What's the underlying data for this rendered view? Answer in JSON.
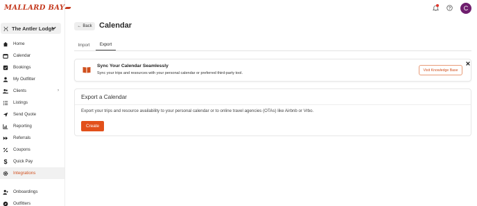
{
  "brand": {
    "logo_text": "MALLARD BAY",
    "accent": "#d0501e",
    "button": "#e2501b"
  },
  "lodge": {
    "name": "The Antler Lodge"
  },
  "sidebar": {
    "items": [
      {
        "label": "Home",
        "icon": "home-icon"
      },
      {
        "label": "Calendar",
        "icon": "calendar-icon"
      },
      {
        "label": "Bookings",
        "icon": "bookings-icon"
      },
      {
        "label": "My Outfitter",
        "icon": "user-icon"
      },
      {
        "label": "Clients",
        "icon": "users-icon"
      },
      {
        "label": "Listings",
        "icon": "list-icon"
      },
      {
        "label": "Send Quote",
        "icon": "send-icon"
      },
      {
        "label": "Reporting",
        "icon": "chart-icon"
      },
      {
        "label": "Referrals",
        "icon": "fast-forward-icon"
      },
      {
        "label": "Coupons",
        "icon": "percent-icon"
      },
      {
        "label": "Quick Pay",
        "icon": "dollar-icon"
      },
      {
        "label": "Integrations",
        "icon": "gear-icon"
      },
      {
        "label": "Onboardings",
        "icon": "user-plus-icon"
      },
      {
        "label": "Outfitters",
        "icon": "compass-icon"
      }
    ],
    "active": "Integrations"
  },
  "header": {
    "avatar_initial": "C"
  },
  "page": {
    "back_label": "Back",
    "title": "Calendar"
  },
  "tabs": [
    {
      "label": "Import"
    },
    {
      "label": "Export"
    }
  ],
  "banner": {
    "title": "Sync Your Calendar Seamlessly",
    "subtitle": "Sync your trips and resources with your personal calendar or preferred third-party tool.",
    "button_label": "Visit Knowledge Base"
  },
  "export_card": {
    "title": "Export a Calendar",
    "description": "Export your trips and resource availability to your personal calendar or to online travel agencies (OTAs) like Airbnb or Vrbo.",
    "button_label": "Create"
  }
}
